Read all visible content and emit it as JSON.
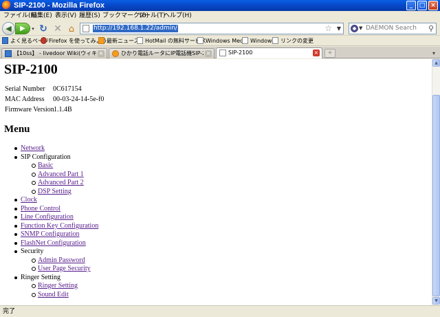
{
  "window": {
    "title": "SIP-2100 - Mozilla Firefox",
    "minimize_glyph": "_",
    "maximize_glyph": "□",
    "close_glyph": "×"
  },
  "menubar": [
    "ファイル(F)",
    "編集(E)",
    "表示(V)",
    "履歴(S)",
    "ブックマーク(B)",
    "ツール(T)",
    "ヘルプ(H)"
  ],
  "navbar": {
    "back_glyph": "◀",
    "forward_glyph": "▶",
    "history_glyph": "▾",
    "reload_glyph": "↻",
    "stop_glyph": "✕",
    "home_glyph": "⌂",
    "url": "http://192.168.1.22/admin/",
    "bookmark_star_glyph": "☆",
    "url_dropdown_glyph": "▼",
    "search_placeholder": "DAEMON Search",
    "search_engine_dropdown_glyph": "▼",
    "search_glyph": "⚲",
    "icons": {
      "back": "back-arrow-icon",
      "forward": "forward-arrow-icon",
      "reload": "reload-icon",
      "stop": "stop-icon",
      "home": "home-icon",
      "bookmark": "star-icon",
      "search": "magnifier-icon"
    }
  },
  "bookmarks": [
    {
      "label": "よく見るページ",
      "icon": "page-icon"
    },
    {
      "label": "Firefox を使ってみよう",
      "icon": "firefox-bug-icon"
    },
    {
      "label": "最新ニュース",
      "icon": "rss-icon"
    },
    {
      "label": "HotMail の無料サービス",
      "icon": "page-icon"
    },
    {
      "label": "Windows Media",
      "icon": "page-icon"
    },
    {
      "label": "Windows",
      "icon": "page-icon"
    },
    {
      "label": "リンクの変更",
      "icon": "page-icon"
    }
  ],
  "tabs": [
    {
      "label": "【10ss】 - livedoor Wiki(ウィキ)",
      "active": false,
      "icon": "livedoor-icon"
    },
    {
      "label": "ひかり電話ルータにIP電話機SIP-2100P...",
      "active": false,
      "icon": "orange-s-icon"
    },
    {
      "label": "SIP-2100",
      "active": true,
      "icon": "page-icon"
    }
  ],
  "tab_close_glyph": "×",
  "new_tab_glyph": "+",
  "tab_list_glyph": "▾",
  "page": {
    "title": "SIP-2100",
    "info": [
      {
        "label": "Serial Number",
        "value": "0C617154"
      },
      {
        "label": "MAC Address",
        "value": "00-03-24-14-5e-f0"
      },
      {
        "label": "Firmware Version",
        "value": "1.1.4B"
      }
    ],
    "menu_heading": "Menu",
    "menu": [
      {
        "label": "Network",
        "link": true,
        "level": 1
      },
      {
        "label": "SIP Configuration",
        "link": false,
        "level": 1
      },
      {
        "label": "Basic",
        "link": true,
        "level": 2
      },
      {
        "label": "Advanced Part 1",
        "link": true,
        "level": 2
      },
      {
        "label": "Advanced Part 2",
        "link": true,
        "level": 2
      },
      {
        "label": "DSP Setting",
        "link": true,
        "level": 2
      },
      {
        "label": "Clock",
        "link": true,
        "level": 1
      },
      {
        "label": "Phone Control",
        "link": true,
        "level": 1
      },
      {
        "label": "Line Configuration",
        "link": true,
        "level": 1
      },
      {
        "label": "Function Key Configuration",
        "link": true,
        "level": 1
      },
      {
        "label": "SNMP Configuration",
        "link": true,
        "level": 1
      },
      {
        "label": "FlashNet Configuration",
        "link": true,
        "level": 1
      },
      {
        "label": "Security",
        "link": false,
        "level": 1
      },
      {
        "label": "Admin Password",
        "link": true,
        "level": 2
      },
      {
        "label": "User Page Security",
        "link": true,
        "level": 2
      },
      {
        "label": "Ringer Setting",
        "link": false,
        "level": 1
      },
      {
        "label": "Ringer Setting",
        "link": true,
        "level": 2
      },
      {
        "label": "Sound Edit",
        "link": true,
        "level": 2
      }
    ]
  },
  "scrollbar": {
    "up_glyph": "▲",
    "down_glyph": "▼"
  },
  "status": "完了"
}
